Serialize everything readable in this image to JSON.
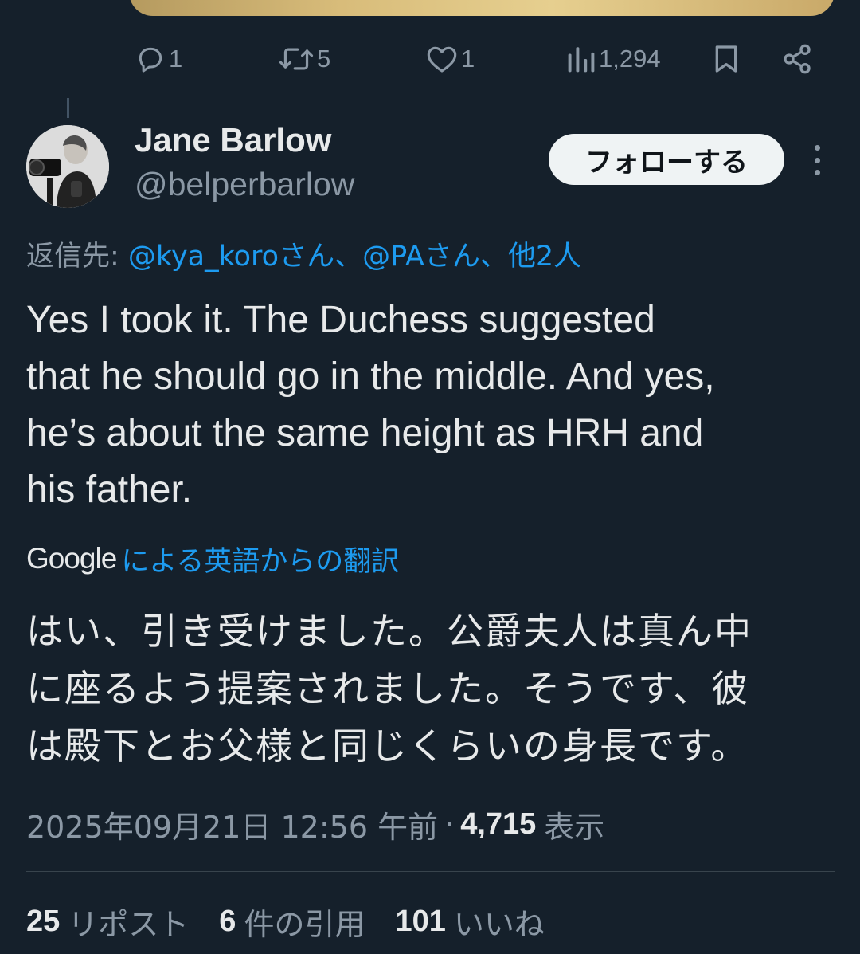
{
  "actions": {
    "reply": {
      "icon": "reply-icon",
      "count": "1"
    },
    "repost": {
      "icon": "repost-icon",
      "count": "5"
    },
    "like": {
      "icon": "heart-icon",
      "count": "1"
    },
    "views": {
      "icon": "analytics-icon",
      "count": "1,294"
    },
    "bookmark": {
      "icon": "bookmark-icon"
    },
    "share": {
      "icon": "share-icon"
    }
  },
  "author": {
    "display_name": "Jane Barlow",
    "handle": "@belperbarlow"
  },
  "follow_label": "フォローする",
  "reply_to": {
    "prefix": "返信先: ",
    "mentions": "@kya_koroさん、@PAさん、他2人"
  },
  "tweet": {
    "lines": [
      "Yes I took it. The Duchess suggested",
      "that he should go in the middle. And yes,",
      "he’s about the same height as HRH and",
      "his father."
    ]
  },
  "translation": {
    "provider": "Google",
    "label": "による英語からの翻訳",
    "lines": [
      "はい、引き受けました。公爵夫人は真ん中",
      "に座るよう提案されました。そうです、彼",
      "は殿下とお父様と同じくらいの身長です。"
    ]
  },
  "meta": {
    "timestamp": "2025年09月21日 12:56 午前",
    "separator": "·",
    "views_count": "4,715",
    "views_label": "表示"
  },
  "stats": {
    "reposts": {
      "count": "25",
      "label": "リポスト"
    },
    "quotes": {
      "count": "6",
      "label": "件の引用"
    },
    "likes": {
      "count": "101",
      "label": "いいね"
    }
  },
  "colors": {
    "background": "#15202b",
    "text": "#e7e9ea",
    "muted": "#8b98a5",
    "link": "#1d9bf0",
    "button_bg": "#eff3f4"
  }
}
